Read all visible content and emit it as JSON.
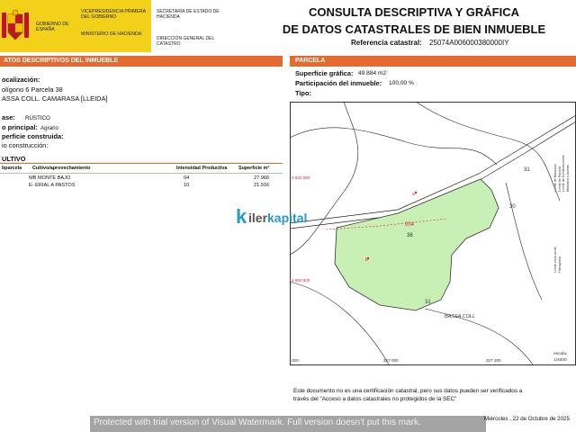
{
  "header": {
    "gobierno": "GOBIERNO DE ESPAÑA",
    "vicepresidencia": "VICEPRESIDENCIA PRIMERA DEL GOBIERNO",
    "ministerio": "MINISTERIO DE HACIENDA",
    "secretaria": "SECRETARÍA DE ESTADO DE HACIENDA",
    "direccion": "DIRECCIÓN GENERAL DEL CATASTRO",
    "title_line1": "CONSULTA DESCRIPTIVA Y GRÁFICA",
    "title_line2": "DE DATOS CATASTRALES DE BIEN INMUEBLE",
    "ref_label": "Referencia catastral:",
    "ref_value": "25074A006000380000IY"
  },
  "left": {
    "section_title": "ATOS DESCRIPTIVOS DEL INMUEBLE",
    "localizacion_label": "ocalización:",
    "localizacion_line1": "olígono 6 Parcela 38",
    "localizacion_line2": "ASSA COLL. CAMARASA [LLEIDA]",
    "clase_label": "ase:",
    "clase_value": "RÚSTICO",
    "uso_label": "o principal:",
    "uso_value": "Agrario",
    "superficie_label": "perficie construida:",
    "anio_label": "io construcción:",
    "cultivo_title": "ULTIVO",
    "table_headers": [
      "bparcela",
      "Cultivo/aprovechamiento",
      "Intensidad Productiva",
      "Superficie m²"
    ],
    "rows": [
      {
        "sub": "",
        "cultivo": "MB MONTE BAJO",
        "intensidad": "04",
        "superficie": "27.966"
      },
      {
        "sub": "",
        "cultivo": "E- ERIAL A PASTOS",
        "intensidad": "10",
        "superficie": "21.916"
      }
    ]
  },
  "right": {
    "section_title": "PARCELA",
    "sup_label": "Superficie gráfica:",
    "sup_value": "49.884 m2",
    "part_label": "Participación del inmueble:",
    "part_value": "100,00 %",
    "tipo_label": "Tipo:"
  },
  "map": {
    "coord_left_top": "4 620 000",
    "coord_left_bottom": "4 680 800",
    "coord_bottom_left": "000",
    "coord_bottom_mid": "327 000",
    "coord_bottom_right": "327 200",
    "parcel_id": "38",
    "subparcel": "004",
    "label_a": "a",
    "label_b": "b",
    "neighbor_31_top": "31",
    "neighbor_30": "30",
    "neighbor_31_bottom": "31",
    "place": "BASSA COLL",
    "legend": [
      "Límite de Manzana",
      "Límite de Parcela",
      "Límite de Construcciones",
      "Mobiliario y aceras",
      "Límite zona verde",
      "Hidrografía"
    ],
    "scale_label": "escala:",
    "scale_value": "1/4000",
    "parcel_color": "#c9f0b4"
  },
  "footer": {
    "note_line1": "Este documento no es una certificación catastral, pero sus datos pueden ser verificados a",
    "note_line2": "través del \"Acceso a datos catastrales no protegidos de la SEC\"",
    "date": "Miércoles , 22 de Octubre de 2025",
    "watermark": "Protected with trial version of Visual Watermark. Full version doesn't put this mark.",
    "logo_k": "k",
    "logo_text_a": "iler",
    "logo_text_b": "kapital"
  }
}
